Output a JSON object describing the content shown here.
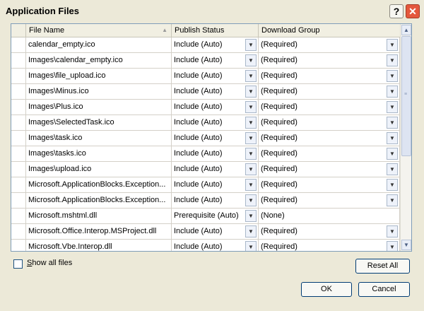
{
  "window": {
    "title": "Application Files",
    "help": "?",
    "close": "✕"
  },
  "grid": {
    "headers": [
      "File Name",
      "Publish Status",
      "Download Group"
    ],
    "sort_arrow": "▲",
    "rows": [
      {
        "file": "calendar_empty.ico",
        "status": "Include (Auto)",
        "group": "(Required)"
      },
      {
        "file": "Images\\calendar_empty.ico",
        "status": "Include (Auto)",
        "group": "(Required)"
      },
      {
        "file": "Images\\file_upload.ico",
        "status": "Include (Auto)",
        "group": "(Required)"
      },
      {
        "file": "Images\\Minus.ico",
        "status": "Include (Auto)",
        "group": "(Required)"
      },
      {
        "file": "Images\\Plus.ico",
        "status": "Include (Auto)",
        "group": "(Required)"
      },
      {
        "file": "Images\\SelectedTask.ico",
        "status": "Include (Auto)",
        "group": "(Required)"
      },
      {
        "file": "Images\\task.ico",
        "status": "Include (Auto)",
        "group": "(Required)"
      },
      {
        "file": "Images\\tasks.ico",
        "status": "Include (Auto)",
        "group": "(Required)"
      },
      {
        "file": "Images\\upload.ico",
        "status": "Include (Auto)",
        "group": "(Required)"
      },
      {
        "file": "Microsoft.ApplicationBlocks.Exception...",
        "status": "Include (Auto)",
        "group": "(Required)"
      },
      {
        "file": "Microsoft.ApplicationBlocks.Exception...",
        "status": "Include (Auto)",
        "group": "(Required)"
      },
      {
        "file": "Microsoft.mshtml.dll",
        "status": "Prerequisite (Auto)",
        "group": "(None)"
      },
      {
        "file": "Microsoft.Office.Interop.MSProject.dll",
        "status": "Include (Auto)",
        "group": "(Required)"
      },
      {
        "file": "Microsoft.Vbe.Interop.dll",
        "status": "Include (Auto)",
        "group": "(Required)"
      }
    ]
  },
  "show_all": {
    "label_accel": "S",
    "label_rest": "how all files",
    "checked": false
  },
  "buttons": {
    "reset": "Reset All",
    "ok": "OK",
    "cancel": "Cancel"
  }
}
